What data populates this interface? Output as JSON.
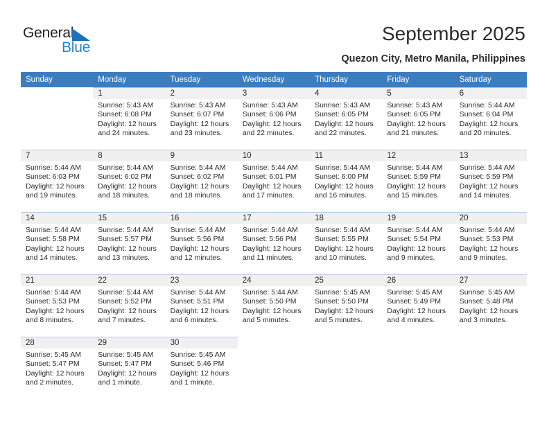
{
  "brand": {
    "name_part1": "General",
    "name_part2": "Blue",
    "triangle_color": "#1b72b8",
    "blue_color": "#1b87d8"
  },
  "header": {
    "title": "September 2025",
    "location": "Quezon City, Metro Manila, Philippines"
  },
  "theme": {
    "header_row_bg": "#3b7dbf",
    "header_row_text": "#ffffff",
    "daynum_band_bg": "#f0f0f0",
    "cell_border": "#b8cce4"
  },
  "weekdays": [
    "Sunday",
    "Monday",
    "Tuesday",
    "Wednesday",
    "Thursday",
    "Friday",
    "Saturday"
  ],
  "calendar": {
    "weeks": [
      [
        {
          "day": "",
          "sunrise": "",
          "sunset": "",
          "daylight1": "",
          "daylight2": ""
        },
        {
          "day": "1",
          "sunrise": "Sunrise: 5:43 AM",
          "sunset": "Sunset: 6:08 PM",
          "daylight1": "Daylight: 12 hours",
          "daylight2": "and 24 minutes."
        },
        {
          "day": "2",
          "sunrise": "Sunrise: 5:43 AM",
          "sunset": "Sunset: 6:07 PM",
          "daylight1": "Daylight: 12 hours",
          "daylight2": "and 23 minutes."
        },
        {
          "day": "3",
          "sunrise": "Sunrise: 5:43 AM",
          "sunset": "Sunset: 6:06 PM",
          "daylight1": "Daylight: 12 hours",
          "daylight2": "and 22 minutes."
        },
        {
          "day": "4",
          "sunrise": "Sunrise: 5:43 AM",
          "sunset": "Sunset: 6:05 PM",
          "daylight1": "Daylight: 12 hours",
          "daylight2": "and 22 minutes."
        },
        {
          "day": "5",
          "sunrise": "Sunrise: 5:43 AM",
          "sunset": "Sunset: 6:05 PM",
          "daylight1": "Daylight: 12 hours",
          "daylight2": "and 21 minutes."
        },
        {
          "day": "6",
          "sunrise": "Sunrise: 5:44 AM",
          "sunset": "Sunset: 6:04 PM",
          "daylight1": "Daylight: 12 hours",
          "daylight2": "and 20 minutes."
        }
      ],
      [
        {
          "day": "7",
          "sunrise": "Sunrise: 5:44 AM",
          "sunset": "Sunset: 6:03 PM",
          "daylight1": "Daylight: 12 hours",
          "daylight2": "and 19 minutes."
        },
        {
          "day": "8",
          "sunrise": "Sunrise: 5:44 AM",
          "sunset": "Sunset: 6:02 PM",
          "daylight1": "Daylight: 12 hours",
          "daylight2": "and 18 minutes."
        },
        {
          "day": "9",
          "sunrise": "Sunrise: 5:44 AM",
          "sunset": "Sunset: 6:02 PM",
          "daylight1": "Daylight: 12 hours",
          "daylight2": "and 18 minutes."
        },
        {
          "day": "10",
          "sunrise": "Sunrise: 5:44 AM",
          "sunset": "Sunset: 6:01 PM",
          "daylight1": "Daylight: 12 hours",
          "daylight2": "and 17 minutes."
        },
        {
          "day": "11",
          "sunrise": "Sunrise: 5:44 AM",
          "sunset": "Sunset: 6:00 PM",
          "daylight1": "Daylight: 12 hours",
          "daylight2": "and 16 minutes."
        },
        {
          "day": "12",
          "sunrise": "Sunrise: 5:44 AM",
          "sunset": "Sunset: 5:59 PM",
          "daylight1": "Daylight: 12 hours",
          "daylight2": "and 15 minutes."
        },
        {
          "day": "13",
          "sunrise": "Sunrise: 5:44 AM",
          "sunset": "Sunset: 5:59 PM",
          "daylight1": "Daylight: 12 hours",
          "daylight2": "and 14 minutes."
        }
      ],
      [
        {
          "day": "14",
          "sunrise": "Sunrise: 5:44 AM",
          "sunset": "Sunset: 5:58 PM",
          "daylight1": "Daylight: 12 hours",
          "daylight2": "and 14 minutes."
        },
        {
          "day": "15",
          "sunrise": "Sunrise: 5:44 AM",
          "sunset": "Sunset: 5:57 PM",
          "daylight1": "Daylight: 12 hours",
          "daylight2": "and 13 minutes."
        },
        {
          "day": "16",
          "sunrise": "Sunrise: 5:44 AM",
          "sunset": "Sunset: 5:56 PM",
          "daylight1": "Daylight: 12 hours",
          "daylight2": "and 12 minutes."
        },
        {
          "day": "17",
          "sunrise": "Sunrise: 5:44 AM",
          "sunset": "Sunset: 5:56 PM",
          "daylight1": "Daylight: 12 hours",
          "daylight2": "and 11 minutes."
        },
        {
          "day": "18",
          "sunrise": "Sunrise: 5:44 AM",
          "sunset": "Sunset: 5:55 PM",
          "daylight1": "Daylight: 12 hours",
          "daylight2": "and 10 minutes."
        },
        {
          "day": "19",
          "sunrise": "Sunrise: 5:44 AM",
          "sunset": "Sunset: 5:54 PM",
          "daylight1": "Daylight: 12 hours",
          "daylight2": "and 9 minutes."
        },
        {
          "day": "20",
          "sunrise": "Sunrise: 5:44 AM",
          "sunset": "Sunset: 5:53 PM",
          "daylight1": "Daylight: 12 hours",
          "daylight2": "and 9 minutes."
        }
      ],
      [
        {
          "day": "21",
          "sunrise": "Sunrise: 5:44 AM",
          "sunset": "Sunset: 5:53 PM",
          "daylight1": "Daylight: 12 hours",
          "daylight2": "and 8 minutes."
        },
        {
          "day": "22",
          "sunrise": "Sunrise: 5:44 AM",
          "sunset": "Sunset: 5:52 PM",
          "daylight1": "Daylight: 12 hours",
          "daylight2": "and 7 minutes."
        },
        {
          "day": "23",
          "sunrise": "Sunrise: 5:44 AM",
          "sunset": "Sunset: 5:51 PM",
          "daylight1": "Daylight: 12 hours",
          "daylight2": "and 6 minutes."
        },
        {
          "day": "24",
          "sunrise": "Sunrise: 5:44 AM",
          "sunset": "Sunset: 5:50 PM",
          "daylight1": "Daylight: 12 hours",
          "daylight2": "and 5 minutes."
        },
        {
          "day": "25",
          "sunrise": "Sunrise: 5:45 AM",
          "sunset": "Sunset: 5:50 PM",
          "daylight1": "Daylight: 12 hours",
          "daylight2": "and 5 minutes."
        },
        {
          "day": "26",
          "sunrise": "Sunrise: 5:45 AM",
          "sunset": "Sunset: 5:49 PM",
          "daylight1": "Daylight: 12 hours",
          "daylight2": "and 4 minutes."
        },
        {
          "day": "27",
          "sunrise": "Sunrise: 5:45 AM",
          "sunset": "Sunset: 5:48 PM",
          "daylight1": "Daylight: 12 hours",
          "daylight2": "and 3 minutes."
        }
      ],
      [
        {
          "day": "28",
          "sunrise": "Sunrise: 5:45 AM",
          "sunset": "Sunset: 5:47 PM",
          "daylight1": "Daylight: 12 hours",
          "daylight2": "and 2 minutes."
        },
        {
          "day": "29",
          "sunrise": "Sunrise: 5:45 AM",
          "sunset": "Sunset: 5:47 PM",
          "daylight1": "Daylight: 12 hours",
          "daylight2": "and 1 minute."
        },
        {
          "day": "30",
          "sunrise": "Sunrise: 5:45 AM",
          "sunset": "Sunset: 5:46 PM",
          "daylight1": "Daylight: 12 hours",
          "daylight2": "and 1 minute."
        },
        {
          "day": "",
          "sunrise": "",
          "sunset": "",
          "daylight1": "",
          "daylight2": ""
        },
        {
          "day": "",
          "sunrise": "",
          "sunset": "",
          "daylight1": "",
          "daylight2": ""
        },
        {
          "day": "",
          "sunrise": "",
          "sunset": "",
          "daylight1": "",
          "daylight2": ""
        },
        {
          "day": "",
          "sunrise": "",
          "sunset": "",
          "daylight1": "",
          "daylight2": ""
        }
      ]
    ]
  }
}
